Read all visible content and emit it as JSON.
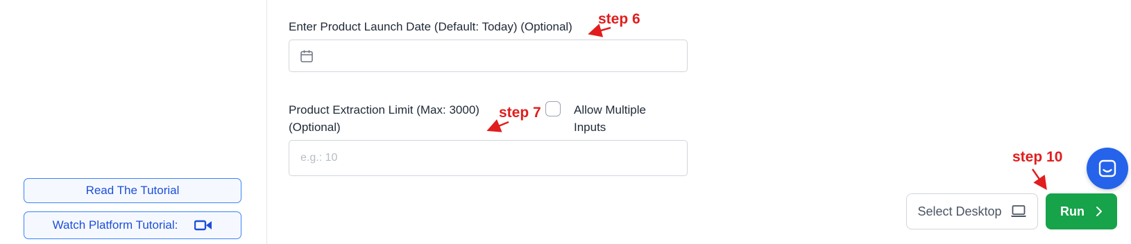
{
  "sidebar": {
    "read_tutorial_label": "Read The Tutorial",
    "watch_tutorial_label": "Watch Platform Tutorial:"
  },
  "form": {
    "launch_date": {
      "label": "Enter Product Launch Date (Default: Today) (Optional)",
      "value": ""
    },
    "extraction_limit": {
      "label_line1": "Product Extraction Limit (Max: 3000)",
      "label_line2": "(Optional)",
      "placeholder": "e.g.: 10"
    },
    "allow_multiple": {
      "label_line1": "Allow Multiple",
      "label_line2": "Inputs",
      "checked": false
    }
  },
  "annotations": {
    "step6": "step 6",
    "step7": "step 7",
    "step10": "step 10"
  },
  "footer": {
    "select_desktop_label": "Select Desktop",
    "run_label": "Run"
  },
  "icons": {
    "calendar": "calendar-icon",
    "video": "video-camera-icon",
    "laptop": "laptop-icon",
    "chevron": "chevron-right-icon",
    "chat": "chat-icon"
  },
  "colors": {
    "accent_blue": "#1d4ed8",
    "run_green": "#16a34a",
    "annotation_red": "#e11d1d",
    "chat_blue": "#2563eb"
  }
}
